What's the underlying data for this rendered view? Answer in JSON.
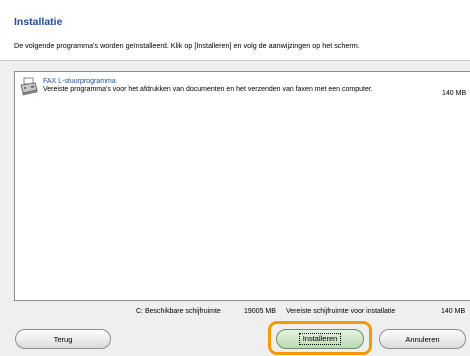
{
  "header": {
    "title": "Installatie",
    "instruction": "De volgende programma's worden geïnstalleerd. Klik op [Installeren] en volg de aanwijzingen op het scherm."
  },
  "programs": [
    {
      "name": "FAX L-stuurprogramma",
      "description": "Vereiste programma's voor het afdrukken van documenten en het verzenden van faxen met een computer.",
      "size": "140 MB",
      "icon": "printer-fax-icon"
    }
  ],
  "disk": {
    "drive_label": "C: Beschikbare schijfruimte",
    "available": "19005 MB",
    "required_label": "Vereiste schijfruimte voor installatie",
    "required": "140 MB"
  },
  "buttons": {
    "back": "Terug",
    "install": "Installeren",
    "cancel": "Annuleren"
  },
  "colors": {
    "accent": "#1d4f99",
    "highlight_ring": "#f29a00",
    "install_button": "#c6e4bd"
  }
}
